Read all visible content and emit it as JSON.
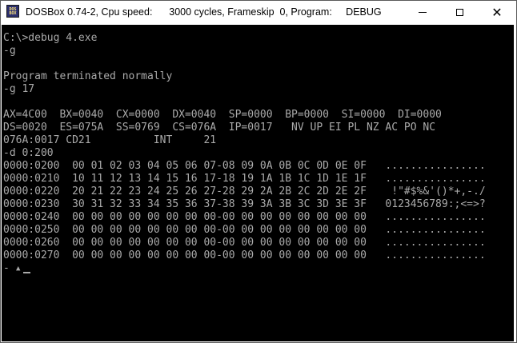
{
  "window": {
    "title": "DOSBox 0.74-2, Cpu speed:      3000 cycles, Frameskip  0, Program:     DEBUG",
    "icon_name": "dosbox-app-icon",
    "icon_text": "DOS BOX",
    "minimize_icon": "minimize-icon",
    "maximize_icon": "maximize-icon",
    "close_icon": "close-icon",
    "close_glyph": "✕"
  },
  "terminal": {
    "background": "#000000",
    "foreground": "#aaaaaa",
    "lines": [
      "C:\\>debug 4.exe",
      "-g",
      "",
      "Program terminated normally",
      "-g 17",
      "",
      "AX=4C00  BX=0040  CX=0000  DX=0040  SP=0000  BP=0000  SI=0000  DI=0000",
      "DS=0020  ES=075A  SS=0769  CS=076A  IP=0017   NV UP EI PL NZ AC PO NC",
      "076A:0017 CD21          INT     21",
      "-d 0:200",
      "0000:0200  00 01 02 03 04 05 06 07-08 09 0A 0B 0C 0D 0E 0F   ................",
      "0000:0210  10 11 12 13 14 15 16 17-18 19 1A 1B 1C 1D 1E 1F   ................",
      "0000:0220  20 21 22 23 24 25 26 27-28 29 2A 2B 2C 2D 2E 2F    !\"#$%&'()*+,-./",
      "0000:0230  30 31 32 33 34 35 36 37-38 39 3A 3B 3C 3D 3E 3F   0123456789:;<=>?",
      "0000:0240  00 00 00 00 00 00 00 00-00 00 00 00 00 00 00 00   ................",
      "0000:0250  00 00 00 00 00 00 00 00-00 00 00 00 00 00 00 00   ................",
      "0000:0260  00 00 00 00 00 00 00 00-00 00 00 00 00 00 00 00   ................",
      "0000:0270  00 00 00 00 00 00 00 00-00 00 00 00 00 00 00 00   ................"
    ],
    "last_line": {
      "dash": "-",
      "arrow": "▲"
    }
  }
}
